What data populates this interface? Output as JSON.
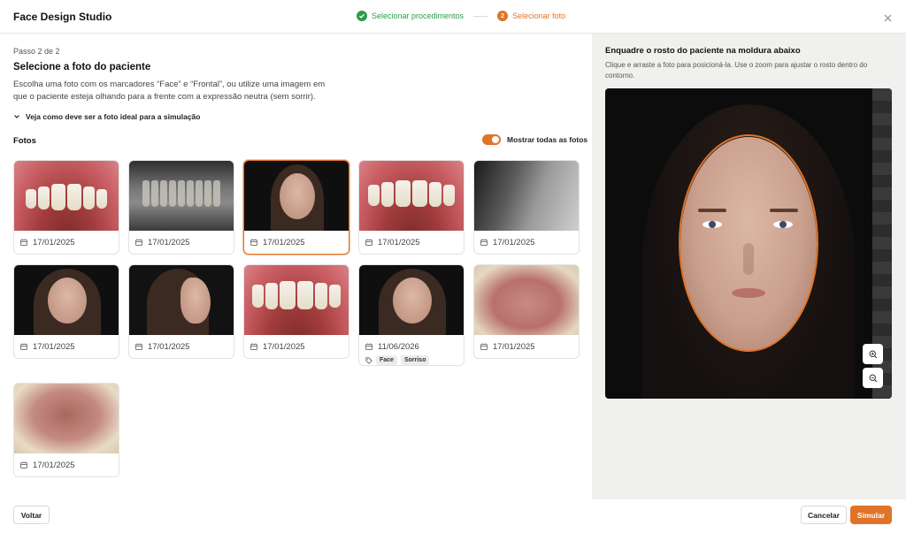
{
  "header": {
    "title": "Face Design Studio",
    "steps": [
      {
        "number": "1",
        "label": "Selecionar procedimentos",
        "status": "done"
      },
      {
        "number": "2",
        "label": "Selecionar foto",
        "status": "active"
      }
    ]
  },
  "left": {
    "step_count": "Passo 2 de 2",
    "title": "Selecione a foto do paciente",
    "description": "Escolha uma foto com os marcadores “Face” e “Frontal”, ou utilize uma imagem em que o paciente esteja olhando para a frente com a expressão neutra (sem sorrir).",
    "guide_toggle": "Veja como deve ser a foto ideal para a simulação",
    "photos_label": "Fotos",
    "show_all_label": "Mostrar todas as fotos",
    "show_all_on": true,
    "photos": [
      {
        "date": "17/01/2025",
        "kind": "intraoral-smile"
      },
      {
        "date": "17/01/2025",
        "kind": "panoramic-xray"
      },
      {
        "date": "17/01/2025",
        "kind": "face-frontal",
        "selected": true
      },
      {
        "date": "17/01/2025",
        "kind": "intraoral-smile"
      },
      {
        "date": "17/01/2025",
        "kind": "cephalometric-xray"
      },
      {
        "date": "17/01/2025",
        "kind": "face-smile"
      },
      {
        "date": "17/01/2025",
        "kind": "face-profile"
      },
      {
        "date": "17/01/2025",
        "kind": "intraoral-front"
      },
      {
        "date": "11/06/2026",
        "kind": "face-smile",
        "tags": [
          "Face",
          "Sorriso"
        ]
      },
      {
        "date": "17/01/2025",
        "kind": "occlusal-upper"
      },
      {
        "date": "17/01/2025",
        "kind": "occlusal-arch"
      }
    ]
  },
  "right": {
    "title": "Enquadre o rosto do paciente na moldura abaixo",
    "subtitle": "Clique e arraste a foto para posicioná-la. Use o zoom para ajustar o rosto dentro do contorno."
  },
  "footer": {
    "back_label": "Voltar",
    "cancel_label": "Cancelar",
    "simulate_label": "Simular"
  },
  "colors": {
    "accent": "#e07328",
    "success": "#2e9d4a"
  },
  "icons": {
    "step_done": "check-icon",
    "close": "close-icon",
    "expand": "chevron-down-icon",
    "date": "calendar-icon",
    "tag": "tag-icon",
    "zoom_in": "zoom-in-icon",
    "zoom_out": "zoom-out-icon"
  }
}
